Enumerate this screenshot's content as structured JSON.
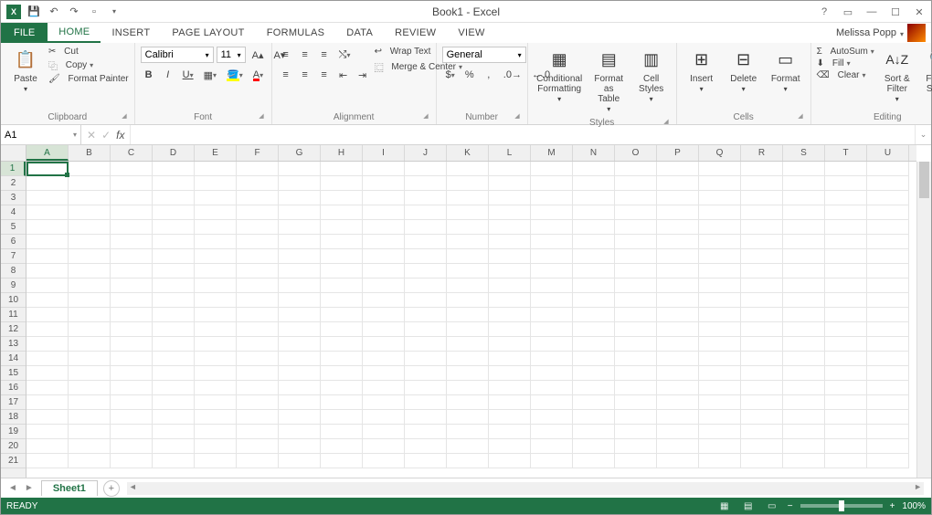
{
  "window": {
    "title": "Book1 - Excel"
  },
  "user": {
    "name": "Melissa Popp"
  },
  "tabs": {
    "file": "FILE",
    "items": [
      "HOME",
      "INSERT",
      "PAGE LAYOUT",
      "FORMULAS",
      "DATA",
      "REVIEW",
      "VIEW"
    ],
    "active": "HOME"
  },
  "ribbon": {
    "clipboard": {
      "label": "Clipboard",
      "paste": "Paste",
      "cut": "Cut",
      "copy": "Copy",
      "format_painter": "Format Painter"
    },
    "font": {
      "label": "Font",
      "name": "Calibri",
      "size": "11",
      "bold": "B",
      "italic": "I",
      "underline": "U"
    },
    "alignment": {
      "label": "Alignment",
      "wrap": "Wrap Text",
      "merge": "Merge & Center"
    },
    "number": {
      "label": "Number",
      "format": "General"
    },
    "styles": {
      "label": "Styles",
      "cond": "Conditional Formatting",
      "table": "Format as Table",
      "cell": "Cell Styles"
    },
    "cells": {
      "label": "Cells",
      "insert": "Insert",
      "delete": "Delete",
      "format": "Format"
    },
    "editing": {
      "label": "Editing",
      "autosum": "AutoSum",
      "fill": "Fill",
      "clear": "Clear",
      "sort": "Sort & Filter",
      "find": "Find & Select"
    }
  },
  "namebox": {
    "cell": "A1"
  },
  "columns": [
    "A",
    "B",
    "C",
    "D",
    "E",
    "F",
    "G",
    "H",
    "I",
    "J",
    "K",
    "L",
    "M",
    "N",
    "O",
    "P",
    "Q",
    "R",
    "S",
    "T",
    "U"
  ],
  "rows": [
    1,
    2,
    3,
    4,
    5,
    6,
    7,
    8,
    9,
    10,
    11,
    12,
    13,
    14,
    15,
    16,
    17,
    18,
    19,
    20,
    21
  ],
  "sheet": {
    "name": "Sheet1"
  },
  "status": {
    "ready": "READY",
    "zoom": "100%"
  }
}
